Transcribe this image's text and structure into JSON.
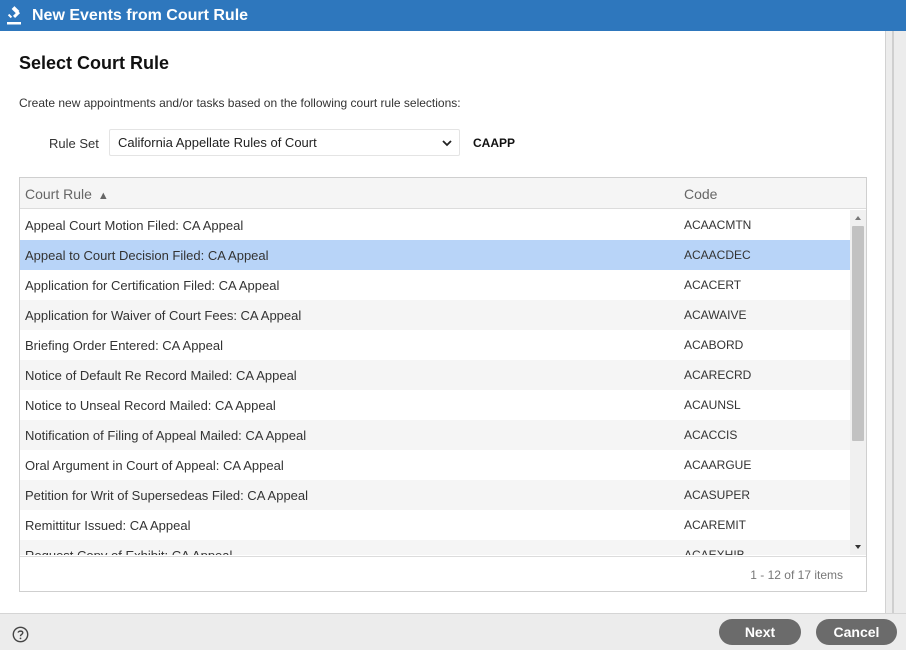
{
  "window": {
    "title": "New Events from Court Rule",
    "icon": "gavel-icon"
  },
  "page": {
    "heading": "Select Court Rule",
    "subtitle": "Create new appointments and/or tasks based on the following court rule selections:"
  },
  "rule_set": {
    "label": "Rule Set",
    "selected": "California Appellate Rules of Court",
    "code": "CAAPP"
  },
  "grid": {
    "columns": {
      "rule": "Court Rule",
      "sort_indicator": "▲",
      "code": "Code"
    },
    "rows": [
      {
        "rule": "Appeal Court Motion Filed: CA Appeal",
        "code": "ACAACMTN"
      },
      {
        "rule": "Appeal to Court Decision Filed: CA Appeal",
        "code": "ACAACDEC"
      },
      {
        "rule": "Application for Certification Filed: CA Appeal",
        "code": "ACACERT"
      },
      {
        "rule": "Application for Waiver of Court Fees: CA Appeal",
        "code": "ACAWAIVE"
      },
      {
        "rule": "Briefing Order Entered: CA Appeal",
        "code": "ACABORD"
      },
      {
        "rule": "Notice of Default Re Record Mailed: CA Appeal",
        "code": "ACARECRD"
      },
      {
        "rule": "Notice to Unseal Record Mailed: CA Appeal",
        "code": "ACAUNSL"
      },
      {
        "rule": "Notification of Filing of Appeal Mailed: CA Appeal",
        "code": "ACACCIS"
      },
      {
        "rule": "Oral Argument in Court of Appeal: CA Appeal",
        "code": "ACAARGUE"
      },
      {
        "rule": "Petition for Writ of Supersedeas Filed: CA Appeal",
        "code": "ACASUPER"
      },
      {
        "rule": "Remittitur Issued: CA Appeal",
        "code": "ACAREMIT"
      },
      {
        "rule": "Request Copy of Exhibit: CA Appeal",
        "code": "ACAEXHIB"
      }
    ],
    "selected_row": 1,
    "pager": "1 - 12 of 17 items"
  },
  "footer": {
    "next_label": "Next",
    "cancel_label": "Cancel",
    "help_icon": "help-icon"
  },
  "colors": {
    "titlebar": "#2e77bd",
    "selected_row": "#b8d4f8",
    "button": "#6b6b6b"
  }
}
